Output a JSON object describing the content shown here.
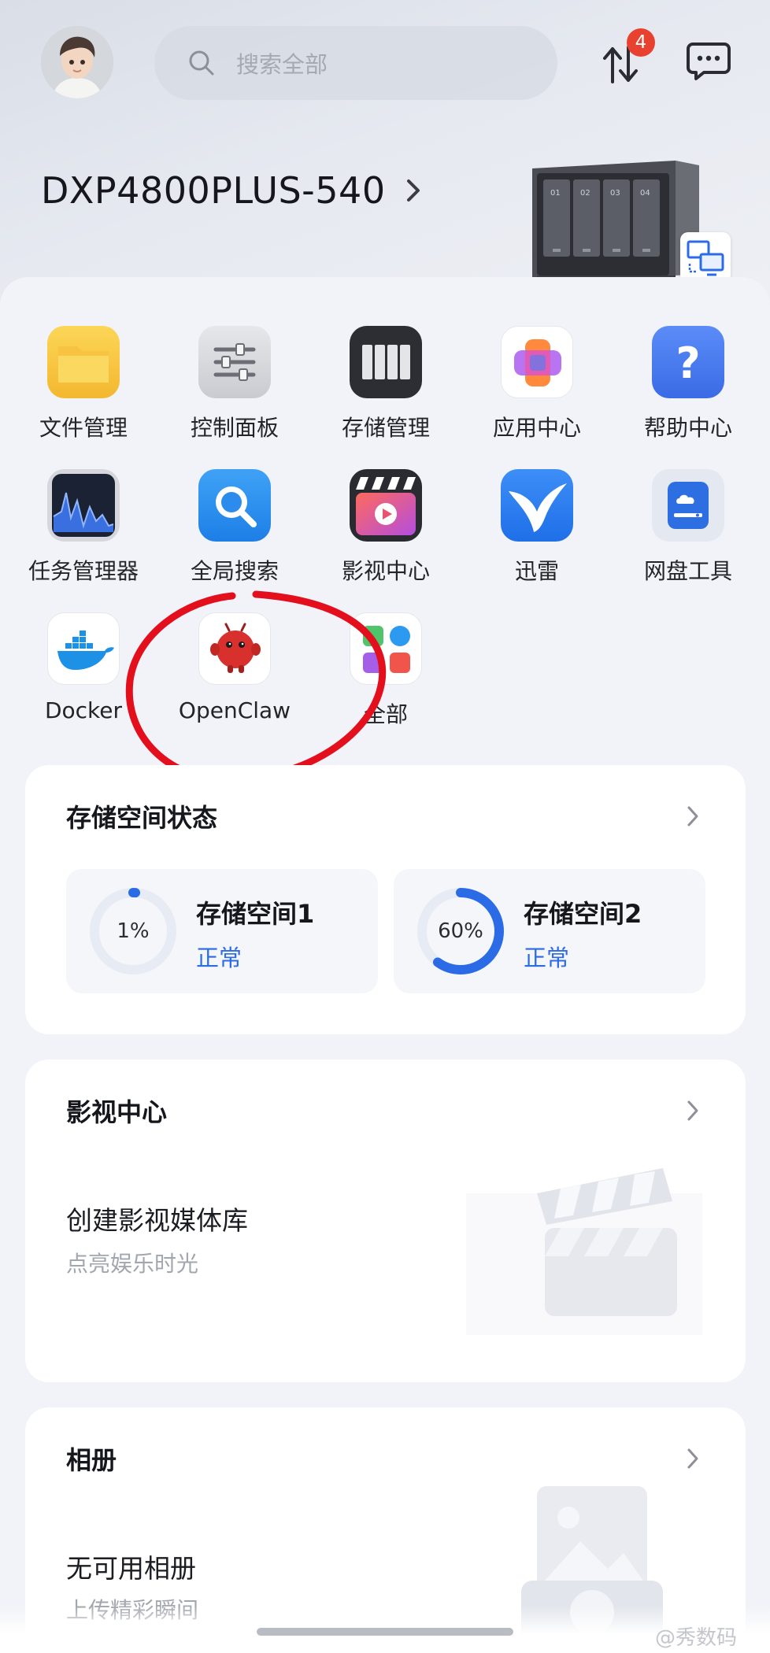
{
  "header": {
    "search_placeholder": "搜索全部",
    "transfer_badge": "4",
    "device_name": "DXP4800PLUS-540"
  },
  "apps": [
    {
      "label": "文件管理",
      "icon": "folder-icon"
    },
    {
      "label": "控制面板",
      "icon": "sliders-icon"
    },
    {
      "label": "存储管理",
      "icon": "drives-icon"
    },
    {
      "label": "应用中心",
      "icon": "app-store-icon"
    },
    {
      "label": "帮助中心",
      "icon": "help-icon"
    },
    {
      "label": "任务管理器",
      "icon": "activity-chart-icon"
    },
    {
      "label": "全局搜索",
      "icon": "magnifier-icon"
    },
    {
      "label": "影视中心",
      "icon": "clapperboard-icon"
    },
    {
      "label": "迅雷",
      "icon": "bird-icon"
    },
    {
      "label": "网盘工具",
      "icon": "cloud-drive-icon"
    },
    {
      "label": "Docker",
      "icon": "docker-whale-icon"
    },
    {
      "label": "OpenClaw",
      "icon": "red-creature-icon"
    },
    {
      "label": "全部",
      "icon": "grid-apps-icon"
    }
  ],
  "storage": {
    "title": "存储空间状态",
    "volumes": [
      {
        "name": "存储空间1",
        "usage_label": "1%",
        "usage": 0.01,
        "status": "正常"
      },
      {
        "name": "存储空间2",
        "usage_label": "60%",
        "usage": 0.6,
        "status": "正常"
      }
    ]
  },
  "media": {
    "title": "影视中心",
    "main": "创建影视媒体库",
    "sub": "点亮娱乐时光"
  },
  "album": {
    "title": "相册",
    "main": "无可用相册",
    "sub": "上传精彩瞬间"
  },
  "watermark": "@秀数码",
  "colors": {
    "accent": "#2b6ce6",
    "badge": "#e8412f",
    "annotation": "#e30f1c"
  }
}
